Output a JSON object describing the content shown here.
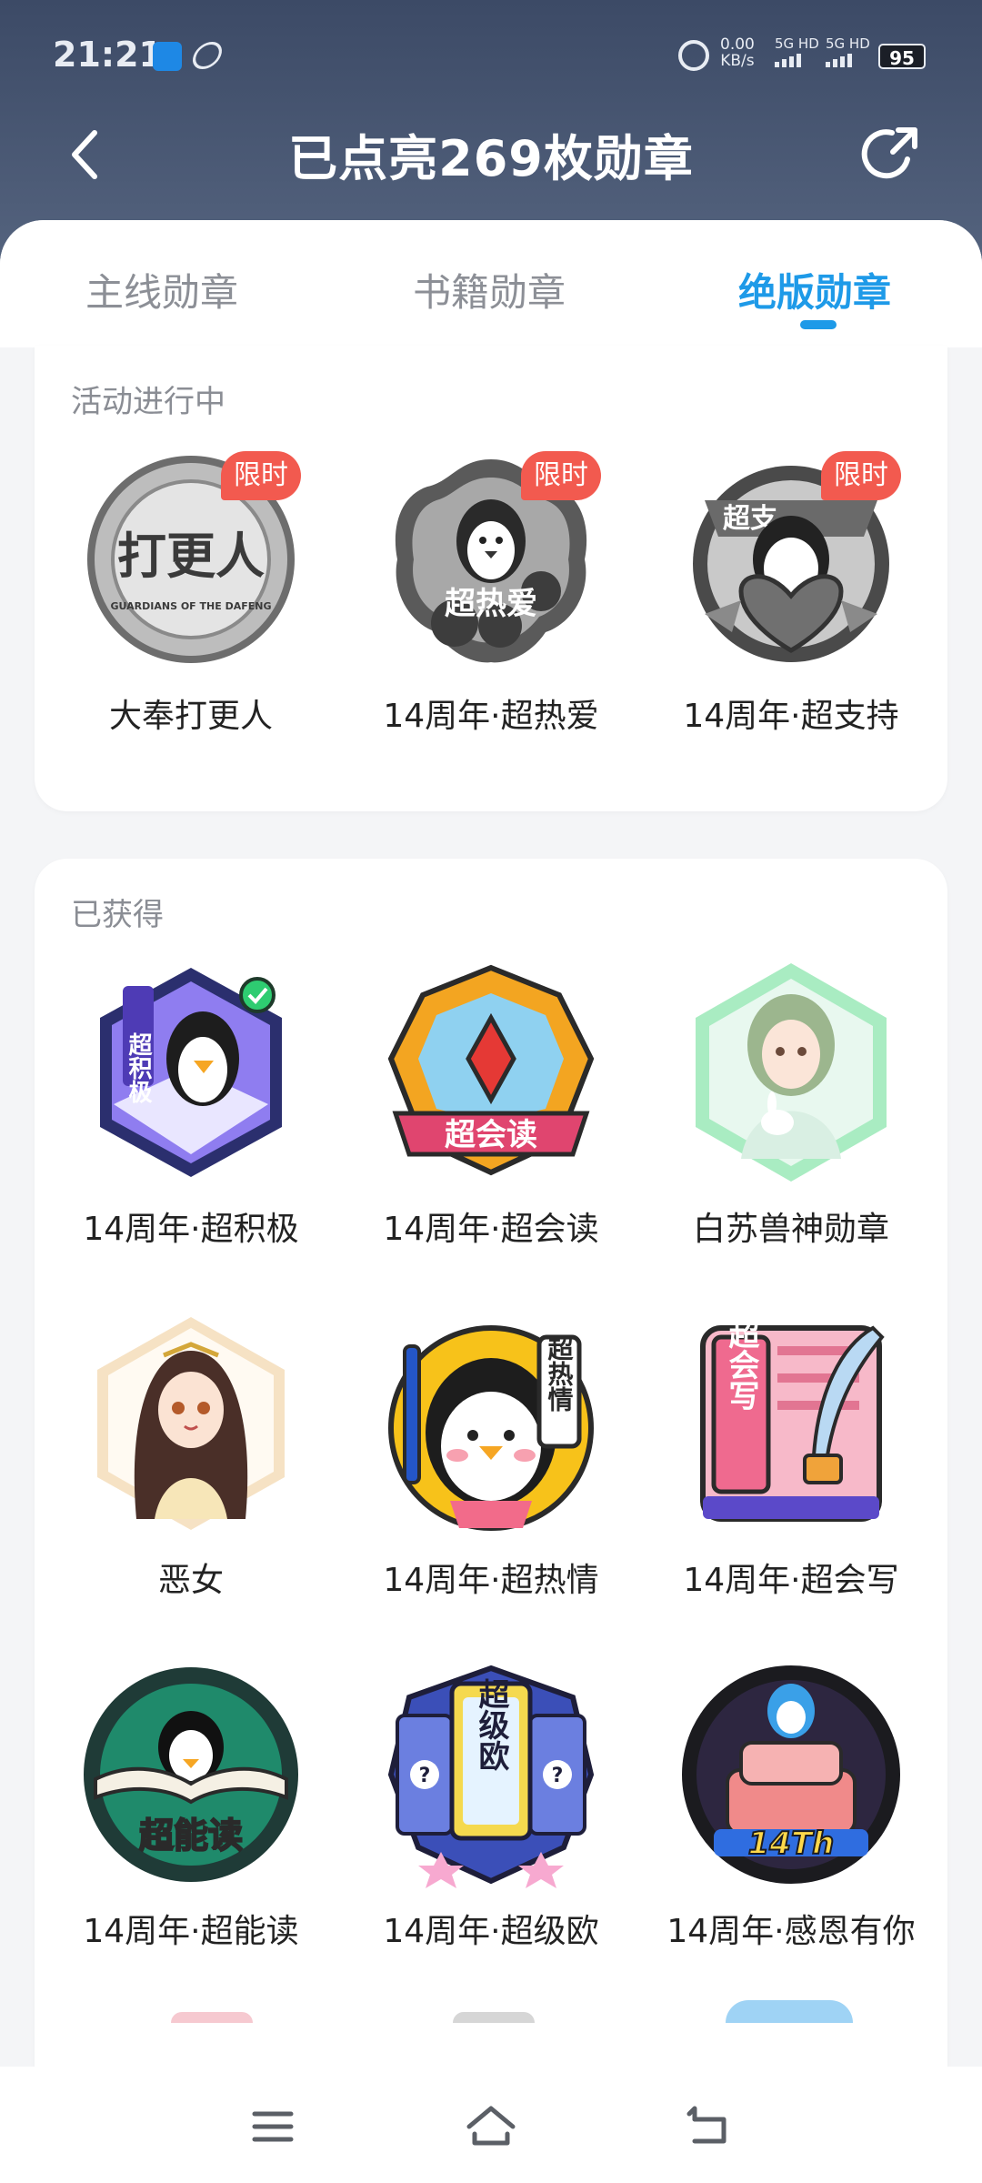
{
  "status_bar": {
    "time": "21:21",
    "net_speed_value": "0.00",
    "net_speed_unit": "KB/s",
    "sim1_label": "5G HD",
    "sim2_label": "5G HD",
    "battery": "95"
  },
  "header": {
    "title": "已点亮269枚勋章"
  },
  "tabs": [
    {
      "label": "主线勋章",
      "active": false
    },
    {
      "label": "书籍勋章",
      "active": false
    },
    {
      "label": "绝版勋章",
      "active": true
    }
  ],
  "active_section": {
    "title": "活动进行中",
    "badges": [
      {
        "label": "大奉打更人",
        "tag": "限时",
        "art_text": "打更人",
        "art_sub": "GUARDIANS OF THE DAFENG",
        "color": "#8f8f8f"
      },
      {
        "label": "14周年·超热爱",
        "tag": "限时",
        "art_text": "超热爱",
        "color": "#7a7a7a"
      },
      {
        "label": "14周年·超支持",
        "tag": "限时",
        "art_text": "超支",
        "color": "#6e6e6e"
      }
    ]
  },
  "owned_section": {
    "title": "已获得",
    "badges": [
      {
        "label": "14周年·超积极",
        "art_text": "超积极",
        "color": "#6a5acd"
      },
      {
        "label": "14周年·超会读",
        "art_text": "超会读",
        "color": "#f5a623"
      },
      {
        "label": "白苏兽神勋章",
        "art_text": "",
        "color": "#8fe3b0"
      },
      {
        "label": "恶女",
        "art_text": "",
        "color": "#f3d9b5"
      },
      {
        "label": "14周年·超热情",
        "art_text": "超热情",
        "color": "#f5c518"
      },
      {
        "label": "14周年·超会写",
        "art_text": "超会写",
        "color": "#f28ba8"
      },
      {
        "label": "14周年·超能读",
        "art_text": "超能读",
        "color": "#1f8a6b"
      },
      {
        "label": "14周年·超级欧",
        "art_text": "超级欧",
        "color": "#3b4fb8"
      },
      {
        "label": "14周年·感恩有你",
        "art_text": "14Th",
        "color": "#f08a8a"
      }
    ]
  },
  "icons": {
    "back": "chevron-left-icon",
    "share": "share-icon",
    "menu": "menu-icon",
    "home": "home-icon",
    "return": "return-icon"
  }
}
